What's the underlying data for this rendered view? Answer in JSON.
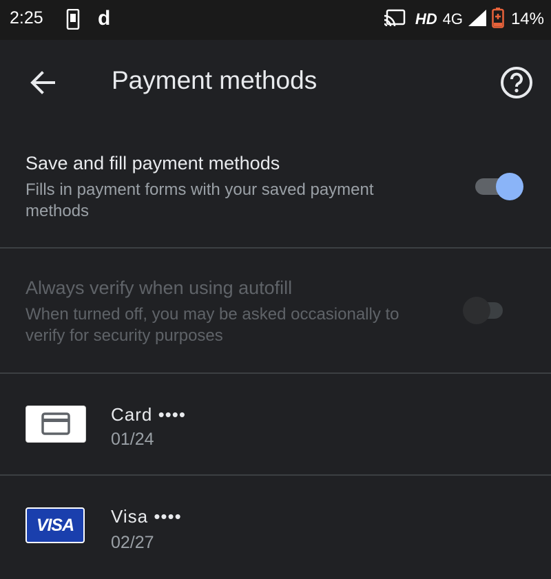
{
  "status_bar": {
    "time": "2:25",
    "d_glyph": "d",
    "hd": "HD",
    "network": "4G",
    "battery": "14%",
    "icons": [
      "phone-icon",
      "cast-icon",
      "signal-icon",
      "battery-icon"
    ]
  },
  "app_bar": {
    "title": "Payment methods",
    "back_icon": "arrow-back-icon",
    "help_icon": "help-circle-icon"
  },
  "settings": {
    "save_fill": {
      "title": "Save and fill payment methods",
      "subtitle": "Fills in payment forms with your saved payment methods",
      "enabled": true
    },
    "verify": {
      "title": "Always verify when using autofill",
      "subtitle": "When turned off, you may be asked occasionally to verify for security purposes",
      "enabled": false,
      "disabled": true
    }
  },
  "cards": [
    {
      "name": "Card ••••",
      "expiry": "01/24",
      "icon": "credit-card-icon"
    },
    {
      "name": "Visa ••••",
      "expiry": "02/27",
      "icon": "visa-logo",
      "logo_text": "VISA"
    }
  ],
  "colors": {
    "background": "#202124",
    "accent": "#8ab4f8",
    "divider": "#3c4043",
    "visa_blue": "#1a3fad"
  }
}
